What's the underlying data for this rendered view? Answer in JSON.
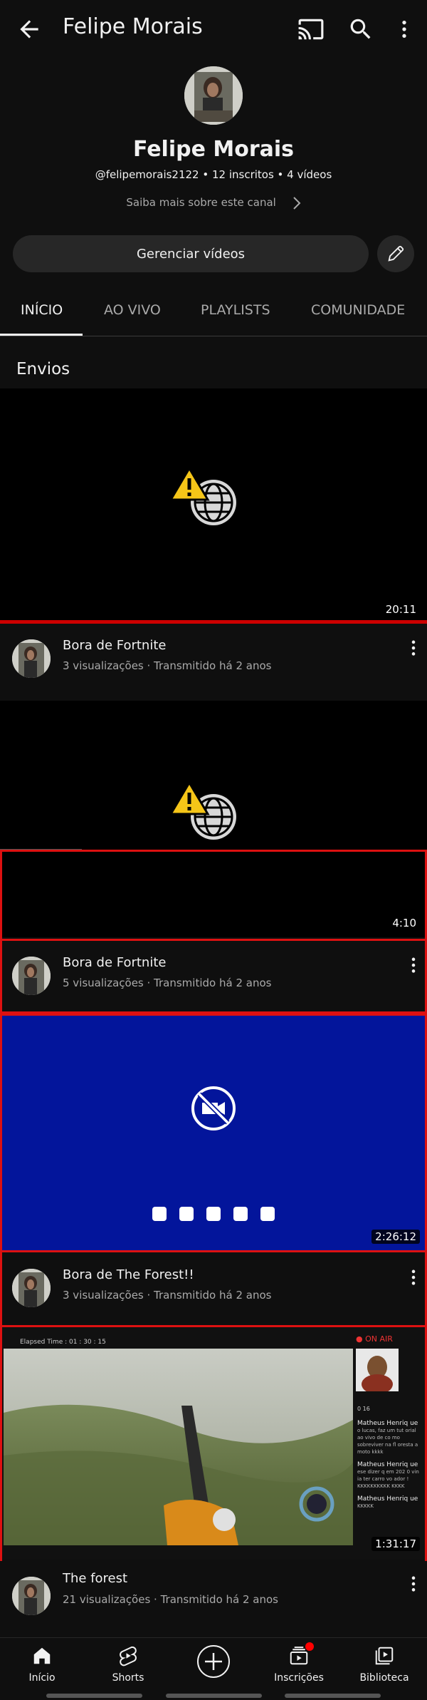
{
  "header": {
    "title": "Felipe Morais",
    "icons": [
      "back-arrow-icon",
      "cast-icon",
      "search-icon",
      "more-vert-icon"
    ]
  },
  "channel": {
    "name": "Felipe Morais",
    "meta": "@felipemorais2122 • 12 inscritos • 4 vídeos",
    "about": "Saiba mais sobre este canal",
    "manage_label": "Gerenciar vídeos"
  },
  "tabs": [
    {
      "label": "INÍCIO",
      "active": true
    },
    {
      "label": "AO VIVO",
      "active": false
    },
    {
      "label": "PLAYLISTS",
      "active": false
    },
    {
      "label": "COMUNIDADE",
      "active": false
    }
  ],
  "section": {
    "title": "Envios"
  },
  "videos": [
    {
      "title": "Bora de Fortnite",
      "meta": "3 visualizações · Transmitido há 2 anos",
      "duration": "20:11"
    },
    {
      "title": "Bora de Fortnite",
      "meta": "5 visualizações · Transmitido há 2 anos",
      "duration": "4:10"
    },
    {
      "title": "Bora de The Forest!!",
      "meta": "3 visualizações · Transmitido há 2 anos",
      "duration": "2:26:12"
    },
    {
      "title": "The forest",
      "meta": "21 visualizações · Transmitido há 2 anos",
      "duration": "1:31:17"
    }
  ],
  "forest_overlay": {
    "elapsed": "Elapsed Time : 01 : 30 : 15",
    "on_air": "● ON AIR",
    "chat": [
      {
        "name": "Matheus Henriq ue",
        "text": "o lucas, faz um tut orial ao vivo de co mo sobreviver na fl oresta a moto kkkk"
      },
      {
        "name": "Matheus Henriq ue",
        "text": "ese dizer q em 202 0 vin ia ter carro vo ador ! KKKKKKKKKK KKKK"
      },
      {
        "name": "Matheus Henriq ue",
        "text": "KKKKK"
      }
    ],
    "stats": "0   16"
  },
  "bottom_nav": [
    {
      "label": "Início",
      "icon": "home-icon"
    },
    {
      "label": "Shorts",
      "icon": "shorts-icon"
    },
    {
      "label": "",
      "icon": "create-plus-icon"
    },
    {
      "label": "Inscrições",
      "icon": "subscriptions-icon"
    },
    {
      "label": "Biblioteca",
      "icon": "library-icon"
    }
  ],
  "colors": {
    "background": "#0f0f0f",
    "accent_red": "#cc0000",
    "thumb_blue": "#03159b"
  }
}
